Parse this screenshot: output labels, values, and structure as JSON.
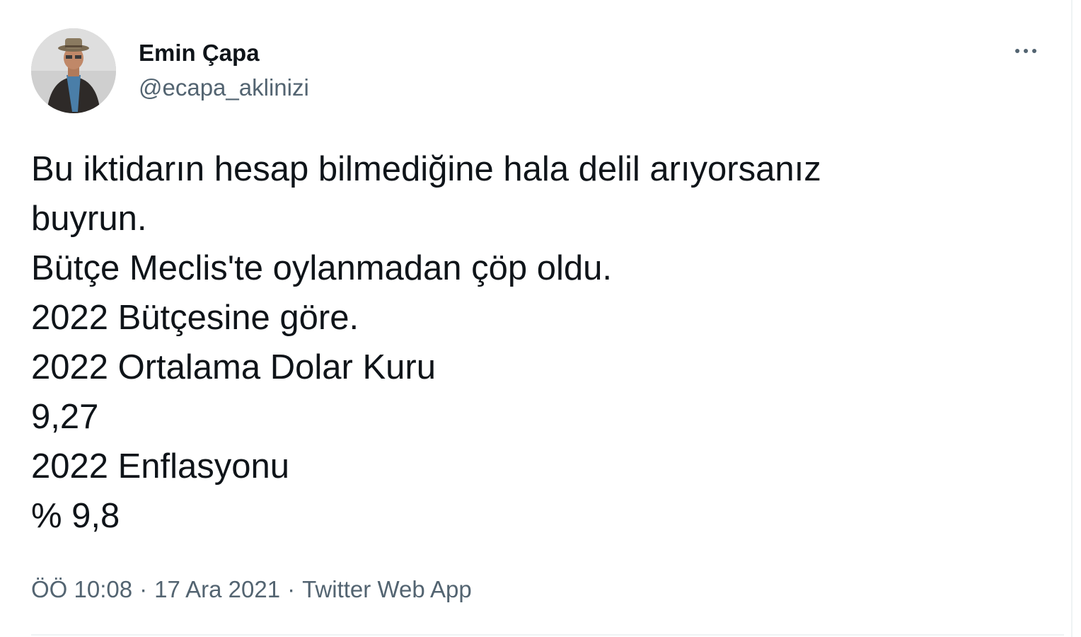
{
  "author": {
    "display_name": "Emin Çapa",
    "handle": "@ecapa_aklinizi",
    "avatar_icon": "user-avatar-photo"
  },
  "menu": {
    "more_icon": "more-horizontal-icon"
  },
  "tweet": {
    "lines": [
      "Bu iktidarın hesap bilmediğine hala delil arıyorsanız",
      "buyrun.",
      "Bütçe Meclis'te oylanmadan çöp oldu.",
      "2022 Bütçesine göre.",
      "2022 Ortalama Dolar Kuru",
      "9,27",
      "2022 Enflasyonu",
      "% 9,8"
    ]
  },
  "meta": {
    "time": "ÖÖ 10:08",
    "separator": "·",
    "date": "17 Ara 2021",
    "source": "Twitter Web App"
  },
  "colors": {
    "text_primary": "#0f1419",
    "text_secondary": "#536471",
    "divider": "#eff3f4"
  }
}
